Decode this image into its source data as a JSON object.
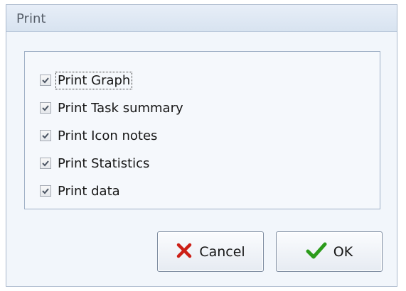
{
  "dialog": {
    "title": "Print",
    "options": [
      {
        "label": "Print Graph",
        "checked": true,
        "focused": true
      },
      {
        "label": "Print Task summary",
        "checked": true
      },
      {
        "label": "Print Icon notes",
        "checked": true
      },
      {
        "label": "Print Statistics",
        "checked": true
      },
      {
        "label": "Print data",
        "checked": true
      }
    ],
    "buttons": {
      "cancel": {
        "label": "Cancel",
        "icon": "x-icon",
        "color": "#cc1f16"
      },
      "ok": {
        "label": "OK",
        "icon": "check-icon",
        "color": "#2c9b1b"
      }
    }
  }
}
